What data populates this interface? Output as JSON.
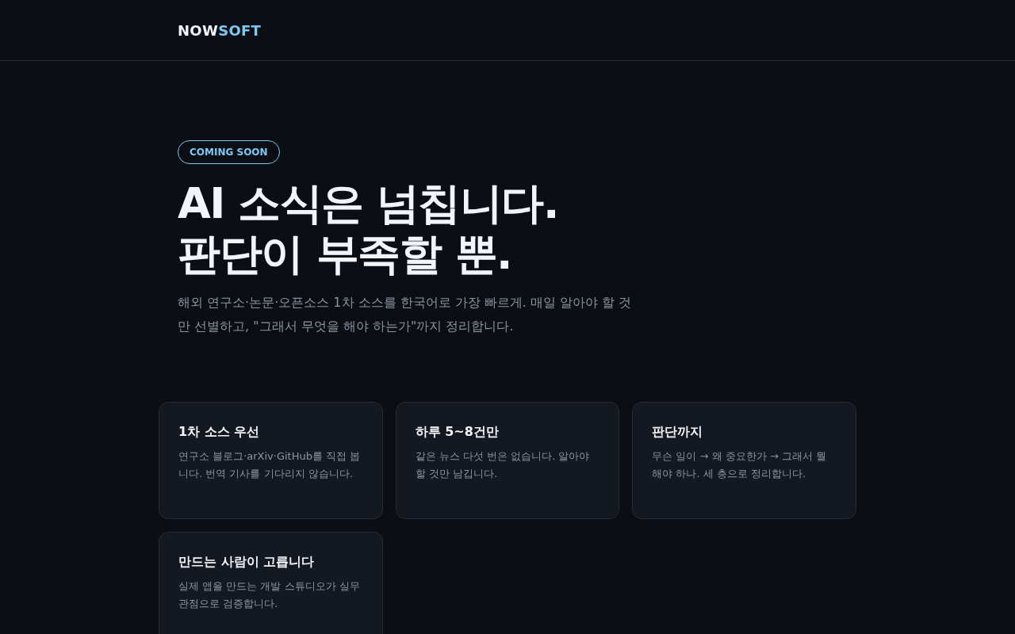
{
  "header": {
    "logo": {
      "primary": "NOW",
      "accent": "SOFT"
    }
  },
  "hero": {
    "badge": "COMING SOON",
    "headline": [
      "AI 소식은 넘칩니다.",
      "판단이 부족할 뿐."
    ],
    "description": "해외 연구소·논문·오픈소스 1차 소스를 한국어로 가장 빠르게. 매일 알아야 할 것만 선별하고, \"그래서 무엇을 해야 하는가\"까지 정리합니다."
  },
  "features": [
    {
      "title": "1차 소스 우선",
      "text": "연구소 블로그·arXiv·GitHub를 직접 봅니다. 번역 기사를 기다리지 않습니다."
    },
    {
      "title": "하루 5~8건만",
      "text": "같은 뉴스 다섯 번은 없습니다. 알아야 할 것만 남깁니다."
    },
    {
      "title": "판단까지",
      "text": "무슨 일이 → 왜 중요한가 → 그래서 뭘 해야 하나. 세 층으로 정리합니다."
    },
    {
      "title": "만드는 사람이 고릅니다",
      "text": "실제 앱을 만드는 개발 스튜디오가 실무 관점으로 검증합니다."
    }
  ]
}
